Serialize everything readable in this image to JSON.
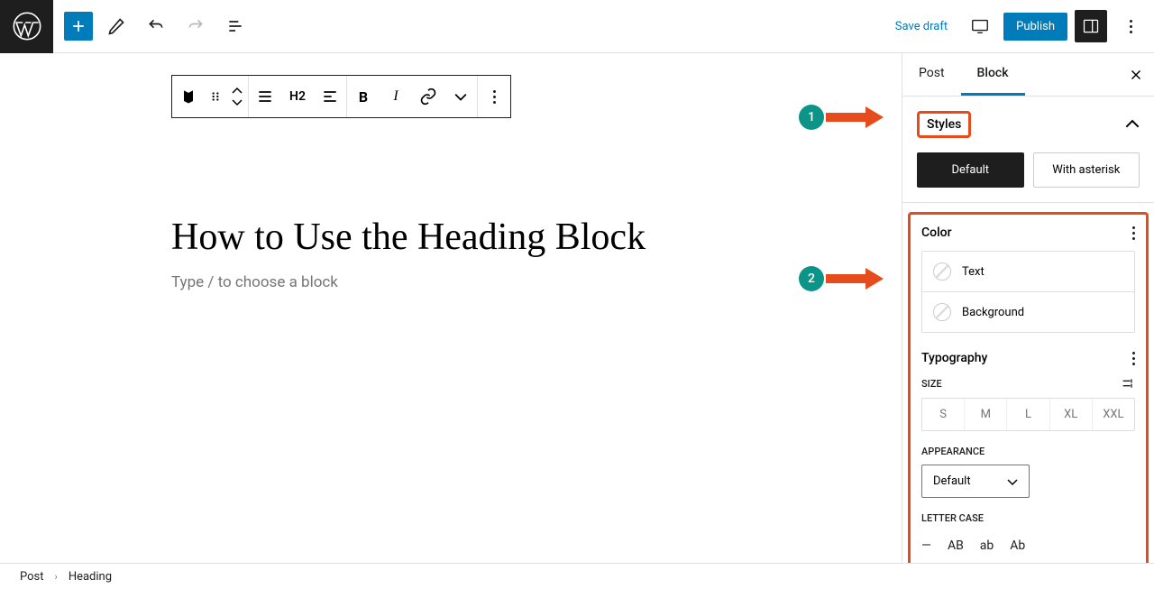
{
  "topbar": {
    "save_draft": "Save draft",
    "publish": "Publish"
  },
  "toolbar": {
    "heading_level": "H2"
  },
  "editor": {
    "heading": "How to Use the Heading Block",
    "placeholder": "Type / to choose a block"
  },
  "sidebar": {
    "tabs": {
      "post": "Post",
      "block": "Block"
    },
    "styles": {
      "title": "Styles",
      "default": "Default",
      "with_asterisk": "With asterisk"
    },
    "color": {
      "title": "Color",
      "text": "Text",
      "background": "Background"
    },
    "typography": {
      "title": "Typography",
      "size_label": "SIZE",
      "sizes": [
        "S",
        "M",
        "L",
        "XL",
        "XXL"
      ],
      "appearance_label": "APPEARANCE",
      "appearance_value": "Default",
      "letter_case_label": "LETTER CASE",
      "cases": [
        "—",
        "AB",
        "ab",
        "Ab"
      ]
    }
  },
  "breadcrumb": {
    "post": "Post",
    "heading": "Heading"
  },
  "annotations": {
    "one": "1",
    "two": "2"
  }
}
